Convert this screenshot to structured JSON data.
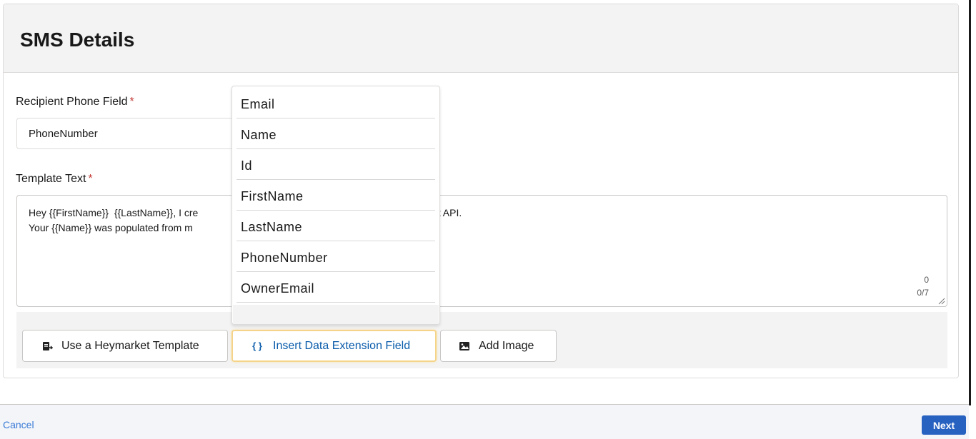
{
  "card": {
    "title": "SMS Details"
  },
  "recipient": {
    "label": "Recipient Phone Field",
    "required_mark": "*",
    "value": "PhoneNumber"
  },
  "template": {
    "label": "Template Text",
    "required_mark": "*",
    "line1": "Hey {{FirstName}}  {{LastName}}, I cre",
    "line1_tail": "et API.",
    "line2": "Your {{Name}} was populated from m",
    "counter_top": "0",
    "counter_bottom": "0/7"
  },
  "toolbar": {
    "heymarket_label": "Use a Heymarket Template",
    "insert_field_label": "Insert Data Extension Field",
    "add_image_label": "Add Image"
  },
  "dropdown": {
    "items": [
      "Email",
      "Name",
      "Id",
      "FirstName",
      "LastName",
      "PhoneNumber",
      "OwnerEmail"
    ]
  },
  "footer": {
    "cancel_label": "Cancel",
    "next_label": "Next"
  },
  "colors": {
    "accent": "#2762c1",
    "link": "#3a7bd5",
    "required": "#c23934",
    "focus_border": "#f5d48a"
  }
}
